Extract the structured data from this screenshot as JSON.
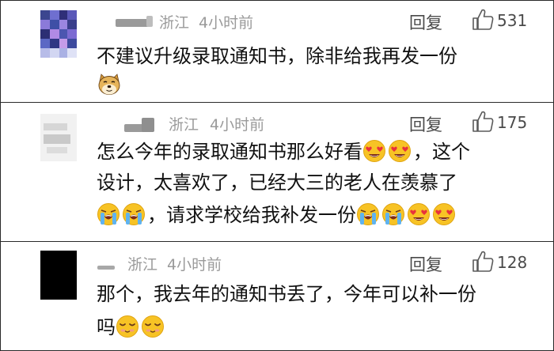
{
  "colors": {
    "meta_text": "#9a9a9a",
    "action_text": "#4a4a4a",
    "body_text": "#111111",
    "border": "#2a2a2a"
  },
  "comments": [
    {
      "location": "浙江",
      "time": "4小时前",
      "reply_label": "回复",
      "likes": "531",
      "lines": [
        "不建议升级录取通知书，除非给我再发一份"
      ],
      "emojis": [
        "doge-emoji"
      ]
    },
    {
      "location": "浙江",
      "time": "4小时前",
      "reply_label": "回复",
      "likes": "175",
      "lines": [
        "怎么今年的录取通知书那么好看",
        "，这个",
        "设计，太喜欢了，已经大三的老人在羡慕了",
        "，请求学校给我补发一份"
      ],
      "emojis": [
        "heart-eyes-emoji",
        "heart-eyes-emoji",
        "crying-emoji",
        "crying-emoji",
        "crying-emoji",
        "crying-emoji",
        "heart-eyes-emoji",
        "heart-eyes-emoji"
      ]
    },
    {
      "location": "浙江",
      "time": "4小时前",
      "reply_label": "回复",
      "likes": "128",
      "lines": [
        "那个，我去年的通知书丢了，今年可以补一份",
        "吗"
      ],
      "emojis": [
        "pleading-emoji",
        "pleading-emoji"
      ]
    }
  ]
}
